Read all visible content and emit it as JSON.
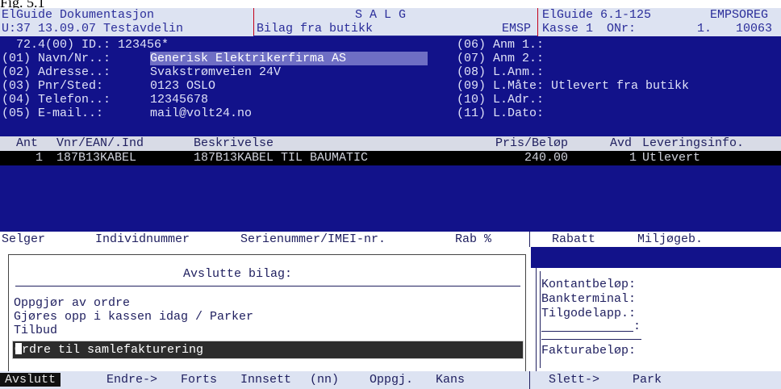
{
  "caption": "Fig. 5.1",
  "header": {
    "row1_left": "ElGuide Dokumentasjon",
    "row1_center": "S A L G",
    "row1_right_app": "ElGuide 6.1-125",
    "row1_right_code": "EMPSOREG",
    "row2_left": "U:37 13.09.07 Testavdelin",
    "row2_doc": "Bilag fra butikk",
    "row2_emsp": "EMSP",
    "row2_kasse": "Kasse 1",
    "row2_onr_label": "ONr:",
    "row2_onr_value": "1.",
    "row2_onr_num": "10063"
  },
  "customer": {
    "id_line": "72.4(00) ID.: 123456*",
    "fields": [
      {
        "label": "(01) Navn/Nr..:",
        "value": "Generisk Elektrikerfirma AS"
      },
      {
        "label": "(02) Adresse..:",
        "value": "Svakstrømveien 24V"
      },
      {
        "label": "(03) Pnr/Sted:",
        "value": "0123 OSLO"
      },
      {
        "label": "(04) Telefon..:",
        "value": "12345678"
      },
      {
        "label": "(05) E-mail..:",
        "value": "mail@volt24.no"
      }
    ],
    "right_fields": [
      "(06) Anm 1.:",
      "(07) Anm 2.:",
      "(08) L.Anm.:",
      "(09) L.Måte: Utlevert fra butikk",
      "(10) L.Adr.:",
      "(11) L.Dato:"
    ]
  },
  "table": {
    "headers": {
      "ant": "Ant",
      "vnr": "Vnr/EAN/.Ind",
      "beskrivelse": "Beskrivelse",
      "pris": "Pris/Beløp",
      "avd": "Avd",
      "lev": "Leveringsinfo."
    },
    "rows": [
      {
        "ant": "1",
        "vnr": "187B13KABEL",
        "beskrivelse": "187B13KABEL TIL BAUMATIC",
        "pris": "240.00",
        "avd": "1",
        "lev": "Utlevert"
      }
    ]
  },
  "sales_header": {
    "selger": "Selger",
    "individ": "Individnummer",
    "serie": "Serienummer/IMEI-nr.",
    "rab": "Rab %",
    "rabatt": "Rabatt",
    "miljo": "Miljøgeb."
  },
  "dialog": {
    "title": "Avslutte bilag:",
    "options": [
      "Oppgjør av ordre",
      "Gjøres opp i kassen idag / Parker",
      "Tilbud",
      "Ordre til samlefakturering"
    ],
    "selected_index": 3
  },
  "payment": {
    "kontant": "Kontantbeløp:",
    "bank": "Bankterminal:",
    "tilgode": "Tilgodelapp.:",
    "blank": ":",
    "faktura": "Fakturabeløp:"
  },
  "function_bar": {
    "keys": [
      "Avslutt",
      "Endre->",
      "Forts",
      "Innsett",
      "(nn)",
      "Oppgj.",
      "Kans",
      "Slett->",
      "Park"
    ],
    "active_index": 0
  }
}
